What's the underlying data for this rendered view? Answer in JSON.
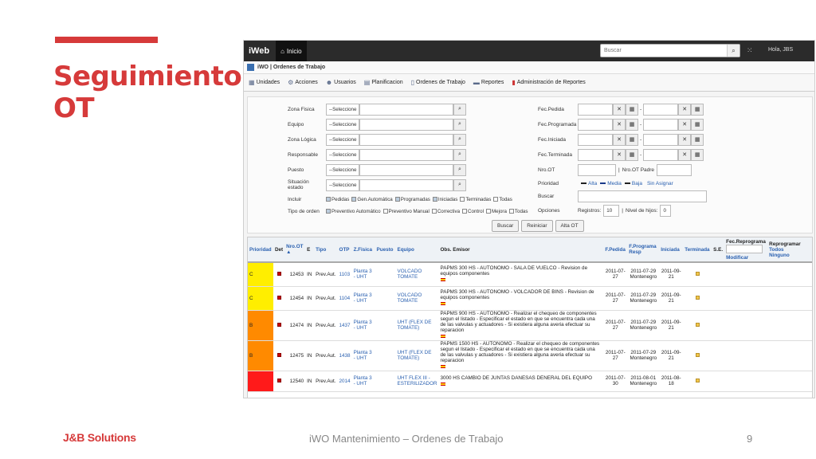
{
  "slide": {
    "title_line1": "Seguimiento",
    "title_line2": "OT",
    "brand": "J&B Solutions",
    "footer_center": "iWO Mantenimiento – Ordenes de Trabajo",
    "page_number": "9",
    "accent_color": "#d63a3a"
  },
  "app": {
    "brand": "iWeb",
    "nav_home": "Inicio",
    "search_placeholder": "Buscar",
    "greeting": "Hola, JBS",
    "module_title": "iWO | Ordenes de Trabajo",
    "menu": [
      "Unidades",
      "Acciones",
      "Usuarios",
      "Planificacion",
      "Ordenes de Trabajo",
      "Reportes",
      "Administración de Reportes"
    ]
  },
  "filters": {
    "left_labels": [
      "Zona Fisica",
      "Equipo",
      "Zona Lógica",
      "Responsable",
      "Puesto",
      "Situación estado"
    ],
    "select_value": "--Seleccione",
    "right_labels": [
      "Fec.Pedida",
      "Fec.Programada",
      "Fec.Iniciada",
      "Fec.Terminada"
    ],
    "nro_ot": "Nro.OT",
    "nro_ot_padre": "Nro.OT Padre",
    "prioridad": "Prioridad",
    "priority_options": [
      "Alta",
      "Media",
      "Baja",
      "Sin Asignar"
    ],
    "priority_colors": [
      "#222222",
      "#1a3a8a",
      "#222222"
    ],
    "buscar_label": "Buscar",
    "incluir_label": "Incluir",
    "incluir_options": [
      {
        "label": "Pedidas",
        "checked": true
      },
      {
        "label": "Gen.Automática",
        "checked": true
      },
      {
        "label": "Programadas",
        "checked": true
      },
      {
        "label": "Iniciadas",
        "checked": true
      },
      {
        "label": "Terminadas",
        "checked": false
      },
      {
        "label": "Todas",
        "checked": false
      }
    ],
    "tipo_label": "Tipo de orden",
    "tipo_options": [
      {
        "label": "Preventivo Automático",
        "checked": true
      },
      {
        "label": "Preventivo Manual",
        "checked": false
      },
      {
        "label": "Correctiva",
        "checked": false
      },
      {
        "label": "Control",
        "checked": false
      },
      {
        "label": "Mejora",
        "checked": false
      },
      {
        "label": "Todas",
        "checked": false
      }
    ],
    "opciones_label": "Opciones",
    "registros_label": "Registros:",
    "registros_value": "10",
    "nivel_label": "Nivel de hijos:",
    "nivel_value": "0",
    "buttons": [
      "Buscar",
      "Reiniciar",
      "Alta OT"
    ]
  },
  "table": {
    "headers": [
      "Prioridad",
      "Det",
      "Nro.OT",
      "E",
      "Tipo",
      "OTP",
      "Z.Fisica",
      "Puesto",
      "Equipo",
      "Obs. Emisor",
      "F.Pedida",
      "F.Programa Resp",
      "Iniciada",
      "Terminada",
      "S.E.",
      "Fec.Reprograma",
      "Reprogramar"
    ],
    "sort_arrow": "▲",
    "fec_reprograma_link": "Modificar",
    "reprogramar_links": [
      "Todos",
      "Ninguno"
    ],
    "rows": [
      {
        "prioridad": "C",
        "color": "#ffee00",
        "nro": "12453",
        "e": "IN",
        "tipo": "Prev.Aut.",
        "otp": "1103",
        "zona": "Planta 3 - UHT",
        "equipo": "VOLCADO TOMATE",
        "obs": "PAPMS 300 HS - AUTONOMO - SALA DE VUELCO - Revision de equipos componentes",
        "f_pedida": "2011-07-27",
        "f_prog": "2011-07-29 Montenegro",
        "iniciada": "2011-09-21"
      },
      {
        "prioridad": "C",
        "color": "#ffee00",
        "nro": "12454",
        "e": "IN",
        "tipo": "Prev.Aut.",
        "otp": "1104",
        "zona": "Planta 3 - UHT",
        "equipo": "VOLCADO TOMATE",
        "obs": "PAPMS 300 HS - AUTONOMO - VOLCADOR DE BINS - Revision de equipos componentes",
        "f_pedida": "2011-07-27",
        "f_prog": "2011-07-29 Montenegro",
        "iniciada": "2011-09-21"
      },
      {
        "prioridad": "B",
        "color": "#ff8a00",
        "nro": "12474",
        "e": "IN",
        "tipo": "Prev.Aut.",
        "otp": "1437",
        "zona": "Planta 3 - UHT",
        "equipo": "UHT (FLEX DE TOMATE)",
        "obs": "PAPMS 900 HS - AUTONOMO - Realizar el chequeo de componentes segun el listado - Especificar el estado en que se encuentra cada una de las valvulas y actuadores - Si existiera alguna averia efectuar su reparacion",
        "f_pedida": "2011-07-27",
        "f_prog": "2011-07-29 Montenegro",
        "iniciada": "2011-09-21"
      },
      {
        "prioridad": "B",
        "color": "#ff8a00",
        "nro": "12475",
        "e": "IN",
        "tipo": "Prev.Aut.",
        "otp": "1438",
        "zona": "Planta 3 - UHT",
        "equipo": "UHT (FLEX DE TOMATE)",
        "obs": "PAPMS 1500 HS - AUTONOMO - Realizar el chequeo de componentes segun el listado - Especificar el estado en que se encuentra cada una de las valvulas y actuadores - Si existiera alguna averia efectuar su reparacion",
        "f_pedida": "2011-07-27",
        "f_prog": "2011-07-29 Montenegro",
        "iniciada": "2011-09-21"
      },
      {
        "prioridad": "",
        "color": "#ff1a1a",
        "nro": "12540",
        "e": "IN",
        "tipo": "Prev.Aut.",
        "otp": "2014",
        "zona": "Planta 3 - UHT",
        "equipo": "UHT FLEX III - ESTERILIZADOR",
        "obs": "3000 HS CAMBIO DE JUNTAS DANESAS DENERAL DEL EQUIPO",
        "f_pedida": "2011-07-30",
        "f_prog": "2011-08-01 Montenegro",
        "iniciada": "2011-08-18"
      }
    ]
  }
}
